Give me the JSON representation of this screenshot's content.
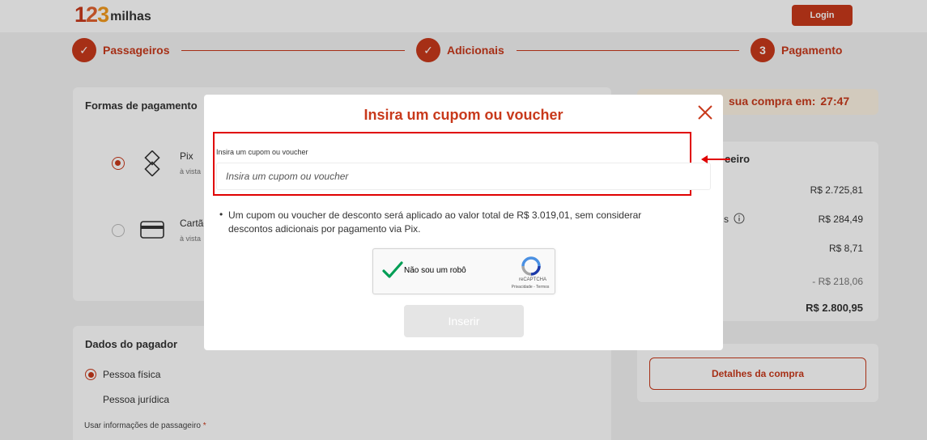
{
  "header": {
    "logo_digits": [
      "1",
      "2",
      "3"
    ],
    "logo_word": "milhas",
    "login_label": "Login"
  },
  "stepper": {
    "steps": [
      {
        "marker": "✓",
        "label": "Passageiros"
      },
      {
        "marker": "✓",
        "label": "Adicionais"
      },
      {
        "marker": "3",
        "label": "Pagamento"
      }
    ]
  },
  "payment": {
    "title": "Formas de pagamento",
    "options": [
      {
        "label": "Pix",
        "sub": "à vista"
      },
      {
        "label": "Cartão",
        "sub": "à vista"
      }
    ]
  },
  "payer": {
    "title": "Dados do pagador",
    "person_types": [
      "Pessoa física",
      "Pessoa jurídica"
    ],
    "use_info_label": "Usar informações de passageiro",
    "required_mark": "*"
  },
  "summary": {
    "timer_label": "sua compra em:",
    "timer_value": "27:47",
    "financial_partial": "ceiro",
    "row2_partial": "s",
    "prices": [
      "R$ 2.725,81",
      "R$ 284,49",
      "R$ 8,71",
      "- R$ 218,06",
      "R$ 2.800,95"
    ],
    "details_label": "Detalhes da compra"
  },
  "modal": {
    "title": "Insira um cupom ou voucher",
    "field_label": "Insira um cupom ou voucher",
    "input_placeholder": "Insira um cupom ou voucher",
    "info_bullet": "•",
    "info_text": "Um cupom ou voucher de desconto será aplicado ao valor total de R$ 3.019,01, sem considerar descontos adicionais por pagamento via Pix.",
    "recaptcha": {
      "label": "Não sou um robô",
      "brand": "reCAPTCHA",
      "links": "Privacidade - Termos"
    },
    "insert_label": "Inserir"
  },
  "colors": {
    "brand": "#c8391b",
    "highlight_box": "#e00000",
    "check_green": "#009e55"
  }
}
